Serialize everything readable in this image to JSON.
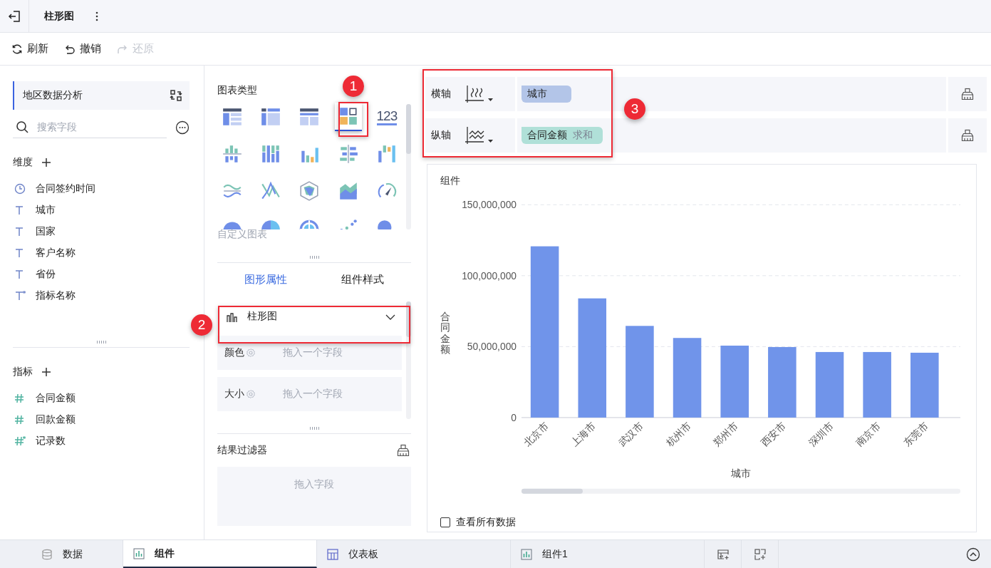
{
  "header": {
    "title": "柱形图"
  },
  "toolbar": [
    {
      "label": "刷新",
      "kind": "refresh",
      "disabled": false
    },
    {
      "label": "撤销",
      "kind": "undo",
      "disabled": false
    },
    {
      "label": "还原",
      "kind": "redo",
      "disabled": true
    }
  ],
  "dataset": {
    "name": "地区数据分析"
  },
  "search": {
    "placeholder": "搜索字段"
  },
  "dimensions": {
    "title": "维度",
    "fields": [
      {
        "name": "合同签约时间",
        "kind": "time"
      },
      {
        "name": "城市",
        "kind": "text"
      },
      {
        "name": "国家",
        "kind": "text"
      },
      {
        "name": "客户名称",
        "kind": "text"
      },
      {
        "name": "省份",
        "kind": "text"
      },
      {
        "name": "指标名称",
        "kind": "text_calc"
      }
    ]
  },
  "measures": {
    "title": "指标",
    "fields": [
      {
        "name": "合同金额",
        "kind": "number"
      },
      {
        "name": "回款金额",
        "kind": "number"
      },
      {
        "name": "记录数",
        "kind": "number_calc"
      }
    ]
  },
  "chart_types": {
    "title": "图表类型",
    "custom": "自定义图表",
    "items": [
      {
        "selected": false
      },
      {
        "selected": false
      },
      {
        "selected": false
      },
      {
        "selected": true
      },
      {
        "selected": false,
        "glyph": "123"
      },
      {
        "selected": false
      },
      {
        "selected": false
      },
      {
        "selected": false
      },
      {
        "selected": false
      },
      {
        "selected": false
      },
      {
        "selected": false
      },
      {
        "selected": false
      },
      {
        "selected": false
      },
      {
        "selected": false
      },
      {
        "selected": false
      },
      {
        "selected": false
      },
      {
        "selected": false
      },
      {
        "selected": false
      },
      {
        "selected": false
      },
      {
        "selected": false
      }
    ]
  },
  "property_tabs": [
    {
      "label": "图形属性",
      "selected": true
    },
    {
      "label": "组件样式",
      "selected": false
    }
  ],
  "chart_kind": {
    "label": "柱形图"
  },
  "marks": [
    {
      "label": "颜色",
      "placeholder": "拖入一个字段"
    },
    {
      "label": "大小",
      "placeholder": "拖入一个字段"
    }
  ],
  "result_filter": {
    "title": "结果过滤器",
    "placeholder": "拖入字段"
  },
  "axes": [
    {
      "label": "横轴",
      "field": "城市",
      "color": "#b3c5e8"
    },
    {
      "label": "纵轴",
      "field": "合同金额",
      "aggregation": "求和",
      "color": "#b0e0d8"
    }
  ],
  "widget": {
    "chart_data": {
      "type": "bar",
      "title": "组件",
      "xlabel": "城市",
      "ylabel": "合同金额",
      "categories": [
        "北京市",
        "上海市",
        "武汉市",
        "杭州市",
        "郑州市",
        "西安市",
        "深圳市",
        "南京市",
        "东莞市"
      ],
      "series": [
        {
          "color": "#7094ea",
          "values": [
            120700000,
            84000000,
            64600000,
            56100000,
            50700000,
            49700000,
            46200000,
            46200000,
            45700000
          ]
        }
      ],
      "ylim": [
        0,
        150000000
      ],
      "yticks": [
        {
          "value": 0,
          "label": "0"
        },
        {
          "value": 50000000,
          "label": "50,000,000"
        },
        {
          "value": 100000000,
          "label": "100,000,000"
        },
        {
          "value": 150000000,
          "label": "150,000,000"
        }
      ]
    },
    "show_all": {
      "label": "查看所有数据",
      "checked": false
    }
  },
  "bottom_tabs": [
    {
      "label": "数据",
      "kind": "data",
      "selected": false
    },
    {
      "label": "组件",
      "kind": "chart",
      "selected": true
    },
    {
      "label": "仪表板",
      "kind": "dashboard",
      "selected": false
    },
    {
      "label": "组件1",
      "kind": "chart",
      "selected": false
    }
  ],
  "annotations": [
    {
      "label": "1"
    },
    {
      "label": "2"
    },
    {
      "label": "3"
    }
  ]
}
